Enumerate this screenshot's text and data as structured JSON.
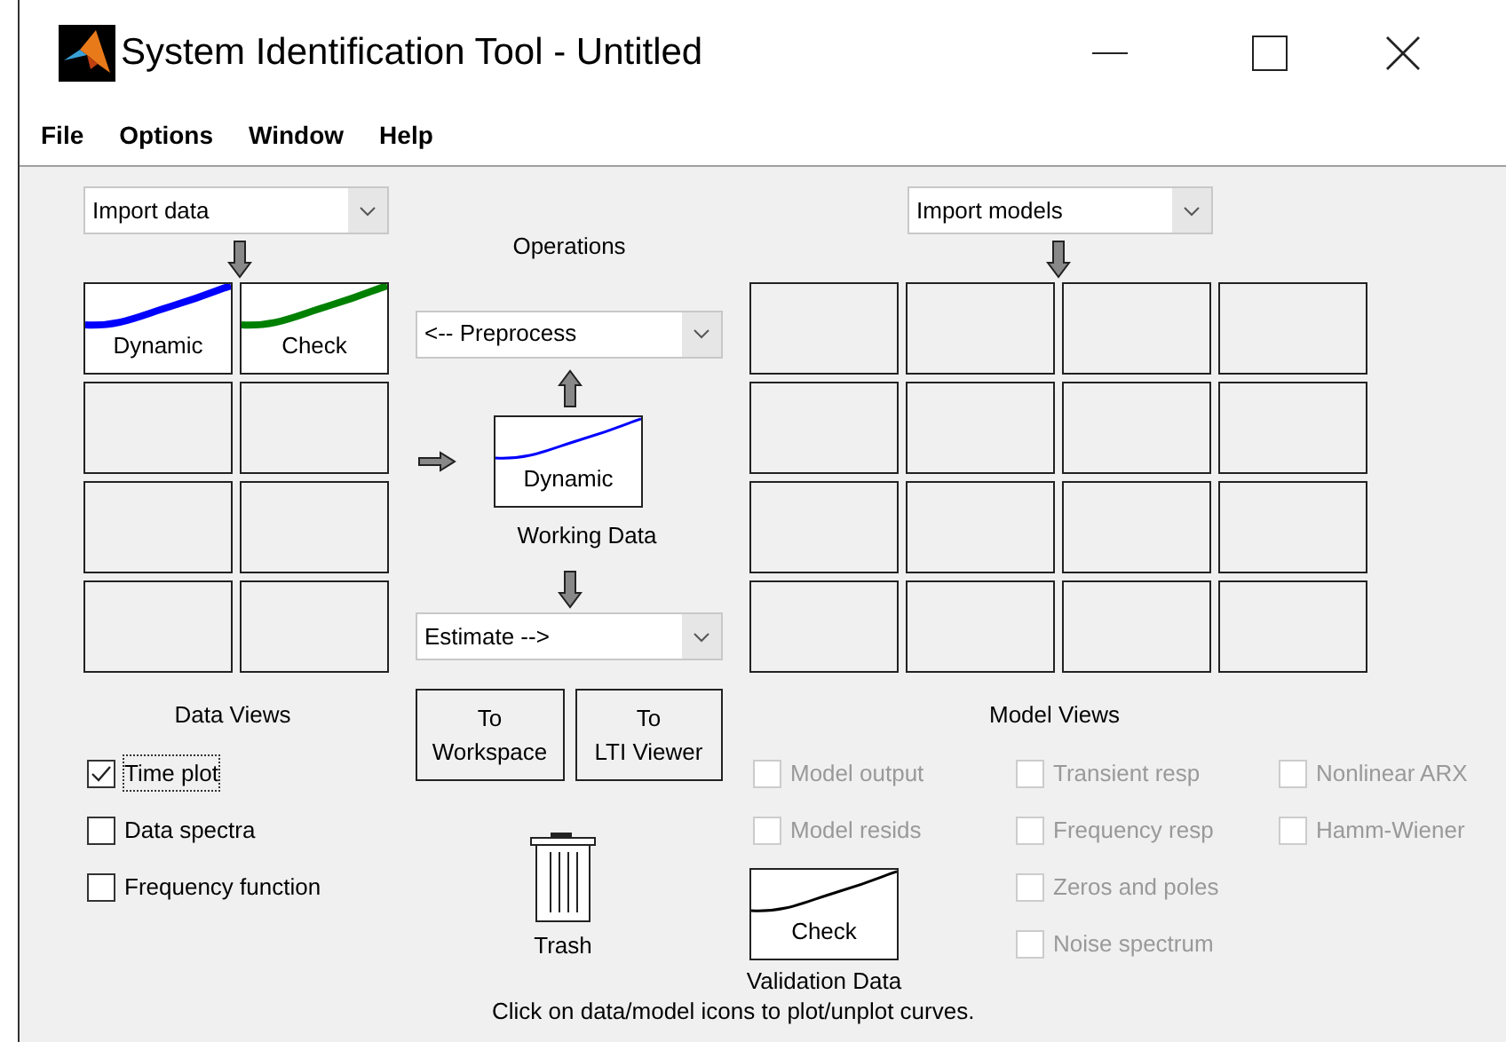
{
  "window": {
    "title": "System Identification Tool - Untitled"
  },
  "menu": [
    "File",
    "Options",
    "Window",
    "Help"
  ],
  "data_import": {
    "value": "Import data"
  },
  "data_board": [
    {
      "label": "Dynamic",
      "color": "#0000ff"
    },
    {
      "label": "Check",
      "color": "#008000"
    }
  ],
  "operations": {
    "title": "Operations",
    "preprocess": "<-- Preprocess",
    "estimate": "Estimate -->"
  },
  "working_data": {
    "label": "Dynamic",
    "caption": "Working Data",
    "color": "#0000ff"
  },
  "model_import": {
    "value": "Import models"
  },
  "data_views": {
    "title": "Data Views",
    "options": [
      {
        "label": "Time plot",
        "checked": true,
        "focused": true
      },
      {
        "label": "Data spectra",
        "checked": false,
        "focused": false
      },
      {
        "label": "Frequency function",
        "checked": false,
        "focused": false
      }
    ]
  },
  "buttons": [
    [
      "To",
      "Workspace"
    ],
    [
      "To",
      "LTI Viewer"
    ]
  ],
  "trash": {
    "label": "Trash"
  },
  "validation_data": {
    "label": "Check",
    "caption": "Validation Data",
    "color": "#000000"
  },
  "model_views": {
    "title": "Model Views",
    "columns": [
      [
        {
          "label": "Model output",
          "checked": false,
          "disabled": true
        },
        {
          "label": "Model resids",
          "checked": false,
          "disabled": true
        }
      ],
      [
        {
          "label": "Transient resp",
          "checked": false,
          "disabled": true
        },
        {
          "label": "Frequency resp",
          "checked": false,
          "disabled": true
        },
        {
          "label": "Zeros and poles",
          "checked": false,
          "disabled": true
        },
        {
          "label": "Noise spectrum",
          "checked": false,
          "disabled": true
        }
      ],
      [
        {
          "label": "Nonlinear ARX",
          "checked": false,
          "disabled": true
        },
        {
          "label": "Hamm-Wiener",
          "checked": false,
          "disabled": true
        }
      ]
    ]
  },
  "footer": "Click on data/model icons to plot/unplot curves."
}
